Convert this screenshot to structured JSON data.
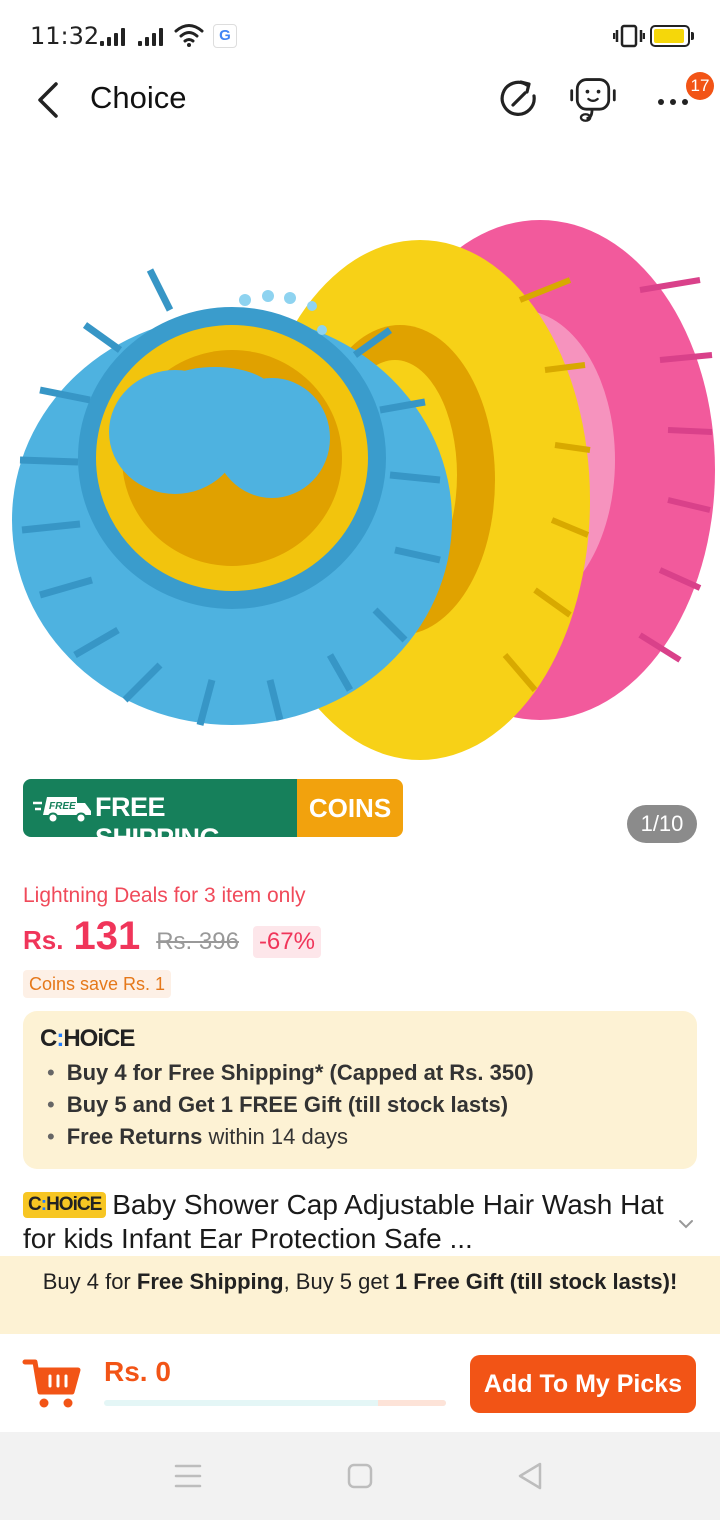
{
  "status_bar": {
    "time": "11:32",
    "google_icon_letter": "G",
    "icons": [
      "signal-icon",
      "signal-icon",
      "wifi-icon",
      "google-icon",
      "vibrate-icon",
      "battery-icon"
    ]
  },
  "header": {
    "title": "Choice",
    "notification_count": "17",
    "icons": [
      "back-arrow-icon",
      "share-icon",
      "customer-service-icon",
      "more-icon"
    ]
  },
  "gallery": {
    "banner_free_shipping": "FREE SHIPPING",
    "banner_free_tag": "FREE",
    "banner_coins": "COINS",
    "pager": "1/10",
    "colors": {
      "green": "#16805b",
      "orange": "#f2a20d"
    }
  },
  "price": {
    "deal_text": "Lightning Deals for 3 item only",
    "currency": "Rs.",
    "current": "131",
    "original": "Rs. 396",
    "discount": "-67%",
    "coins_save": "Coins save Rs. 1",
    "accent": "#f0355a"
  },
  "choice_box": {
    "logo_pre": "C",
    "logo_dot": ":",
    "logo_post": "HOiCE",
    "items": [
      {
        "bold": "Buy 4 for  Free Shipping* (Capped at Rs. 350)",
        "rest": ""
      },
      {
        "bold": "Buy 5 and Get 1 FREE Gift (till stock lasts)",
        "rest": ""
      },
      {
        "bold": "Free Returns",
        "rest": " within 14 days"
      }
    ]
  },
  "product": {
    "tag_pre": "C",
    "tag_dot": ":",
    "tag_post": "HOiCE",
    "title": "Baby Shower Cap Adjustable Hair Wash Hat for kids Infant Ear Protection Safe ..."
  },
  "promo_bar": {
    "p1": "Buy 4 for ",
    "b1": "Free Shipping",
    "p2": ", Buy 5 get ",
    "b2": "1 Free Gift (till stock lasts)",
    "p3": "!"
  },
  "bottom": {
    "cart_total": "Rs. 0",
    "add_button": "Add To My Picks",
    "progress": 0.8,
    "accent": "#f25416"
  },
  "nav_bar": {
    "icons": [
      "menu-icon",
      "home-icon",
      "back-icon"
    ]
  }
}
